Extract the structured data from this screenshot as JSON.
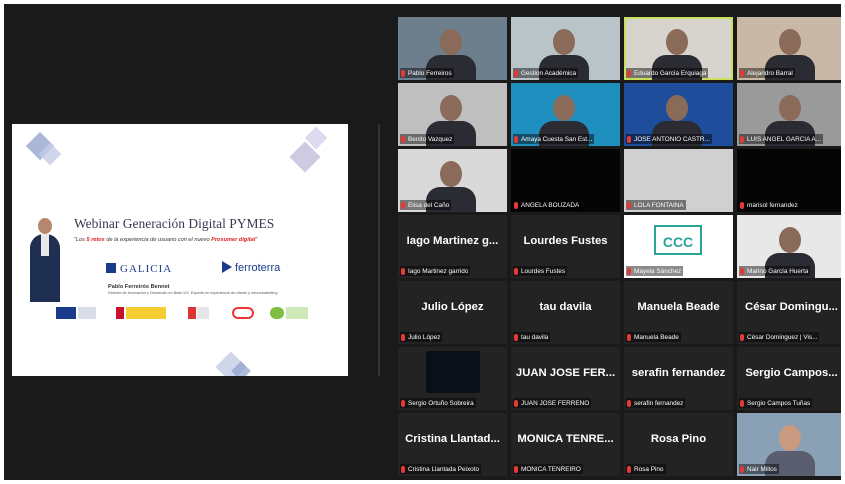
{
  "shared_slide": {
    "title": "Webinar Generación Digital PYMES",
    "subtitle_pre": "“Los ",
    "subtitle_num": "5 retos",
    "subtitle_mid": " de la experiencia de usuario con el nuevo ",
    "subtitle_hl": "Prosumer digital",
    "subtitle_post": "”",
    "logo_galicia": "GALICIA",
    "logo_ferroterra": "ferroterra",
    "presenter_name": "Pablo Ferreirós Bennet",
    "presenter_role": "Director de Innovación y Desarrollo en Brain UX. Experto en experiencia de cliente y neuromarketing"
  },
  "participants": [
    {
      "name": "Pablo Ferreiros",
      "type": "video",
      "bg": "#6d7f8c"
    },
    {
      "name": "Gestion Académica",
      "type": "video",
      "bg": "#b8c4c8"
    },
    {
      "name": "Eduardo García Erquiaga",
      "type": "video",
      "bg": "#d6d4cc",
      "active": true
    },
    {
      "name": "Alejandro Barral",
      "type": "video",
      "bg": "#c9b8a6"
    },
    {
      "name": "Benito Vazquez",
      "type": "video",
      "bg": "#bfbfbf"
    },
    {
      "name": "Amaya Cuesta San Est...",
      "type": "video",
      "bg": "#1f8fbf"
    },
    {
      "name": "JOSE ANTONIO CASTR...",
      "type": "video",
      "bg": "#1e4d9c"
    },
    {
      "name": "LUIS ANGEL GARCIA A...",
      "type": "video",
      "bg": "#9a9a9a"
    },
    {
      "name": "Elisa del Caño",
      "type": "video",
      "bg": "#d9d9d9"
    },
    {
      "name": "ANGELA BOUZADA",
      "type": "black",
      "bg": "#050505"
    },
    {
      "name": "LOLA FONTAIÑA",
      "type": "black",
      "bg": "#d0d0d0"
    },
    {
      "name": "marisol fernandez",
      "type": "black",
      "bg": "#050505"
    },
    {
      "big": "Iago Martinez g...",
      "name": "Iago Martinez garrido",
      "type": "text",
      "bg": "#232323"
    },
    {
      "big": "Lourdes Fustes",
      "name": "Lourdes Fustes",
      "type": "text",
      "bg": "#232323"
    },
    {
      "name": "Mayela Sánchez",
      "type": "logo",
      "bg": "#ffffff"
    },
    {
      "name": "Marino García Huerta",
      "type": "video",
      "bg": "#e8e8e8"
    },
    {
      "big": "Julio López",
      "name": "Julio López",
      "type": "text",
      "bg": "#232323"
    },
    {
      "big": "tau davila",
      "name": "tau davila",
      "type": "text",
      "bg": "#232323"
    },
    {
      "big": "Manuela Beade",
      "name": "Manuela Beade",
      "type": "text",
      "bg": "#232323"
    },
    {
      "big": "César Domingu...",
      "name": "César Dominguez | Vis...",
      "type": "text",
      "bg": "#232323"
    },
    {
      "name": "Sergio Ortuño Sobreira",
      "type": "video",
      "bg": "#232323"
    },
    {
      "big": "JUAN JOSE FER...",
      "name": "JUAN JOSE FERREÑO",
      "type": "text",
      "bg": "#232323"
    },
    {
      "big": "serafin fernandez",
      "name": "serafin fernandez",
      "type": "text",
      "bg": "#232323"
    },
    {
      "big": "Sergio Campos...",
      "name": "Sergio Campos Tuñas",
      "type": "text",
      "bg": "#232323"
    },
    {
      "big": "Cristina Llantad...",
      "name": "Cristina Llantada Peixoto",
      "type": "text",
      "bg": "#232323"
    },
    {
      "big": "MONICA TENRE...",
      "name": "MONICA TENREIRO",
      "type": "text",
      "bg": "#232323"
    },
    {
      "big": "Rosa Pino",
      "name": "Rosa Pino",
      "type": "text",
      "bg": "#232323"
    },
    {
      "name": "Nair Millos",
      "type": "video",
      "bg": "#232323"
    }
  ],
  "colors": {
    "mic_muted": "#e53935",
    "active_speaker": "#c8e05a",
    "app_bg": "#1a1a1a"
  }
}
